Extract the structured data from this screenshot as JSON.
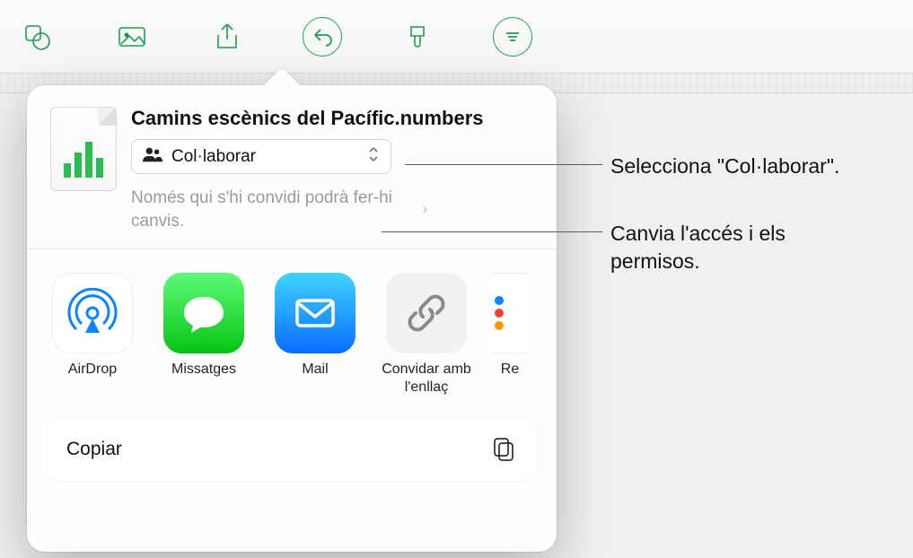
{
  "toolbar": {
    "icons": [
      "shapes",
      "media",
      "share",
      "undo",
      "format-brush",
      "view"
    ]
  },
  "share_sheet": {
    "document_title": "Camins escènics del Pacífic.numbers",
    "mode_label": "Col·laborar",
    "access_note": "Només qui s'hi convidi podrà fer-hi canvis.",
    "apps": [
      {
        "id": "airdrop",
        "label": "AirDrop"
      },
      {
        "id": "messages",
        "label": "Missatges"
      },
      {
        "id": "mail",
        "label": "Mail"
      },
      {
        "id": "link",
        "label": "Convidar amb l'enllaç"
      },
      {
        "id": "reminders",
        "label": "Re"
      }
    ],
    "actions": {
      "copy": "Copiar"
    }
  },
  "callouts": {
    "select_collaborate": "Selecciona \"Col·laborar\".",
    "change_access": "Canvia l'accés i els permisos."
  }
}
